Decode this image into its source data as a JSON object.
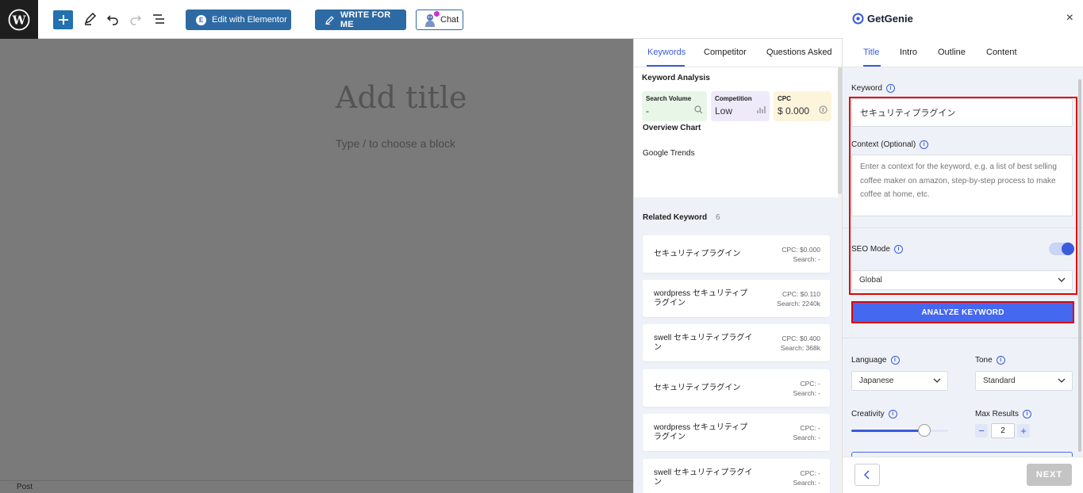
{
  "toolbar": {
    "elementor_label": "Edit with Elementor",
    "write_label": "WRITE FOR ME",
    "chat_label": "Chat"
  },
  "editor": {
    "title_placeholder": "Add title",
    "block_hint": "Type / to choose a block",
    "status": "Post"
  },
  "keyword_panel": {
    "tabs": [
      "Keywords",
      "Competitor",
      "Questions Asked"
    ],
    "active_tab": "Keywords",
    "analysis_title": "Keyword Analysis",
    "metrics": {
      "search_volume": {
        "label": "Search Volume",
        "value": "-"
      },
      "competition": {
        "label": "Competition",
        "value": "Low"
      },
      "cpc": {
        "label": "CPC",
        "value": "$ 0.000"
      }
    },
    "overview_chart": "Overview Chart",
    "google_trends": "Google Trends",
    "related_title": "Related Keyword",
    "related_count": "6",
    "related": [
      {
        "name": "セキュリティプラグイン",
        "cpc": "CPC: $0.000",
        "search": "Search: -"
      },
      {
        "name": "wordpress セキュリティプラグイン",
        "cpc": "CPC: $0.110",
        "search": "Search: 2240k"
      },
      {
        "name": "swell セキュリティプラグイン",
        "cpc": "CPC: $0.400",
        "search": "Search: 368k"
      },
      {
        "name": "セキュリティプラグイン",
        "cpc": "CPC: -",
        "search": "Search: -"
      },
      {
        "name": "wordpress セキュリティプラグイン",
        "cpc": "CPC: -",
        "search": "Search: -"
      },
      {
        "name": "swell セキュリティプラグイン",
        "cpc": "CPC: -",
        "search": "Search: -"
      }
    ]
  },
  "genie": {
    "brand": "GetGenie",
    "close": "×",
    "tabs": [
      "Title",
      "Intro",
      "Outline",
      "Content"
    ],
    "active_tab": "Title",
    "keyword_label": "Keyword",
    "keyword_value": "セキュリティプラグイン",
    "context_label": "Context (Optional)",
    "context_placeholder": "Enter a context for the keyword, e.g. a list of best selling coffee maker on amazon, step-by-step process to make coffee at home, etc.",
    "seo_mode_label": "SEO Mode",
    "seo_mode_on": true,
    "region": "Global",
    "analyze_label": "ANALYZE KEYWORD",
    "language_label": "Language",
    "language_value": "Japanese",
    "tone_label": "Tone",
    "tone_value": "Standard",
    "creativity_label": "Creativity",
    "creativity_level": 0.75,
    "max_results_label": "Max Results",
    "max_results_value": "2",
    "next_label": "NEXT"
  },
  "colors": {
    "accent": "#3b5bdb",
    "wp_blue": "#2271b1",
    "highlight": "#e00000"
  }
}
